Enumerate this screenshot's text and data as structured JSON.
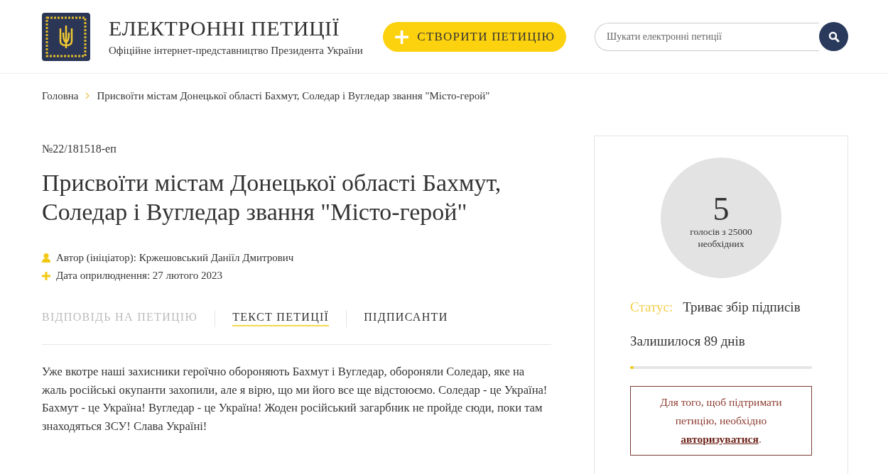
{
  "header": {
    "title": "ЕЛЕКТРОННІ ПЕТИЦІЇ",
    "subtitle": "Офіційне інтернет-представництво Президента України",
    "create_button": {
      "icon": "+",
      "label": "СТВОРИТИ ПЕТИЦІЮ"
    },
    "search": {
      "placeholder": "Шукати електронні петиції"
    }
  },
  "breadcrumbs": [
    {
      "label": "Головна"
    },
    {
      "label": "Присвоїти містам Донецької області Бахмут, Соледар і Вугледар звання \"Місто-герой\""
    }
  ],
  "petition": {
    "number": "№22/181518-еп",
    "title": "Присвоїти містам Донецької області Бахмут, Соледар і Вугледар звання \"Місто-герой\"",
    "meta": [
      {
        "kind": "author",
        "text": "Автор (ініціатор): Кржешовський Даніїл Дмитрович"
      },
      {
        "kind": "date",
        "text": "Дата оприлюднення: 27 лютого 2023"
      }
    ],
    "tabs": [
      {
        "label": "ВІДПОВІДЬ НА ПЕТИЦІЮ",
        "selected": false,
        "disabled": true
      },
      {
        "label": "ТЕКСТ ПЕТИЦІЇ",
        "selected": true,
        "disabled": false
      },
      {
        "label": "ПІДПИСАНТИ",
        "selected": false,
        "disabled": false
      }
    ],
    "text": "Уже вкотре наші захисники героїчно обороняють Бахмут і Вугледар, обороняли Соледар, яке на жаль російські окупанти захопили, але я вірю, що ми його все ще відстоюємо. Соледар - це Україна! Бахмут - це Україна! Вугледар - це Україна! Жоден російський загарбник не пройде сюди, поки там знаходяться ЗСУ! Слава Україні!"
  },
  "sidebar": {
    "votes": {
      "count": "5",
      "caption": "голосів з 25000 необхідних"
    },
    "status_label": "Статус:",
    "status_value": "Триває збір підписів",
    "remaining": "Залишилося 89 днів",
    "time": {
      "level": 0.01
    },
    "notice": {
      "text": "Для того, щоб підтримати петицію, необхідно",
      "link": "авторизуватися",
      "end": "."
    }
  }
}
